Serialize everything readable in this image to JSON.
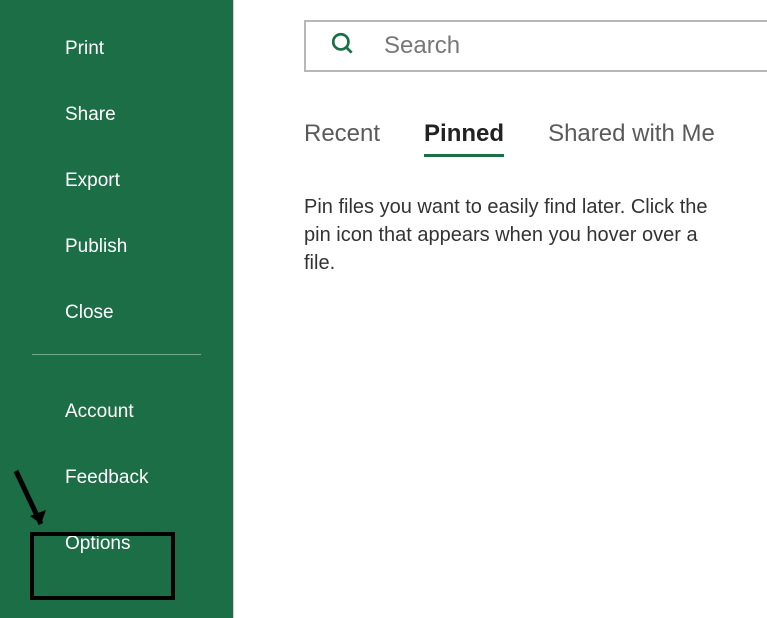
{
  "sidebar": {
    "items": [
      {
        "label": "Print"
      },
      {
        "label": "Share"
      },
      {
        "label": "Export"
      },
      {
        "label": "Publish"
      },
      {
        "label": "Close"
      },
      {
        "label": "Account"
      },
      {
        "label": "Feedback"
      },
      {
        "label": "Options"
      }
    ]
  },
  "search": {
    "placeholder": "Search"
  },
  "tabs": {
    "recent": "Recent",
    "pinned": "Pinned",
    "shared": "Shared with Me"
  },
  "main": {
    "hint": "Pin files you want to easily find later. Click the pin icon that appears when you hover over a file."
  },
  "colors": {
    "brand": "#1c6e46"
  }
}
